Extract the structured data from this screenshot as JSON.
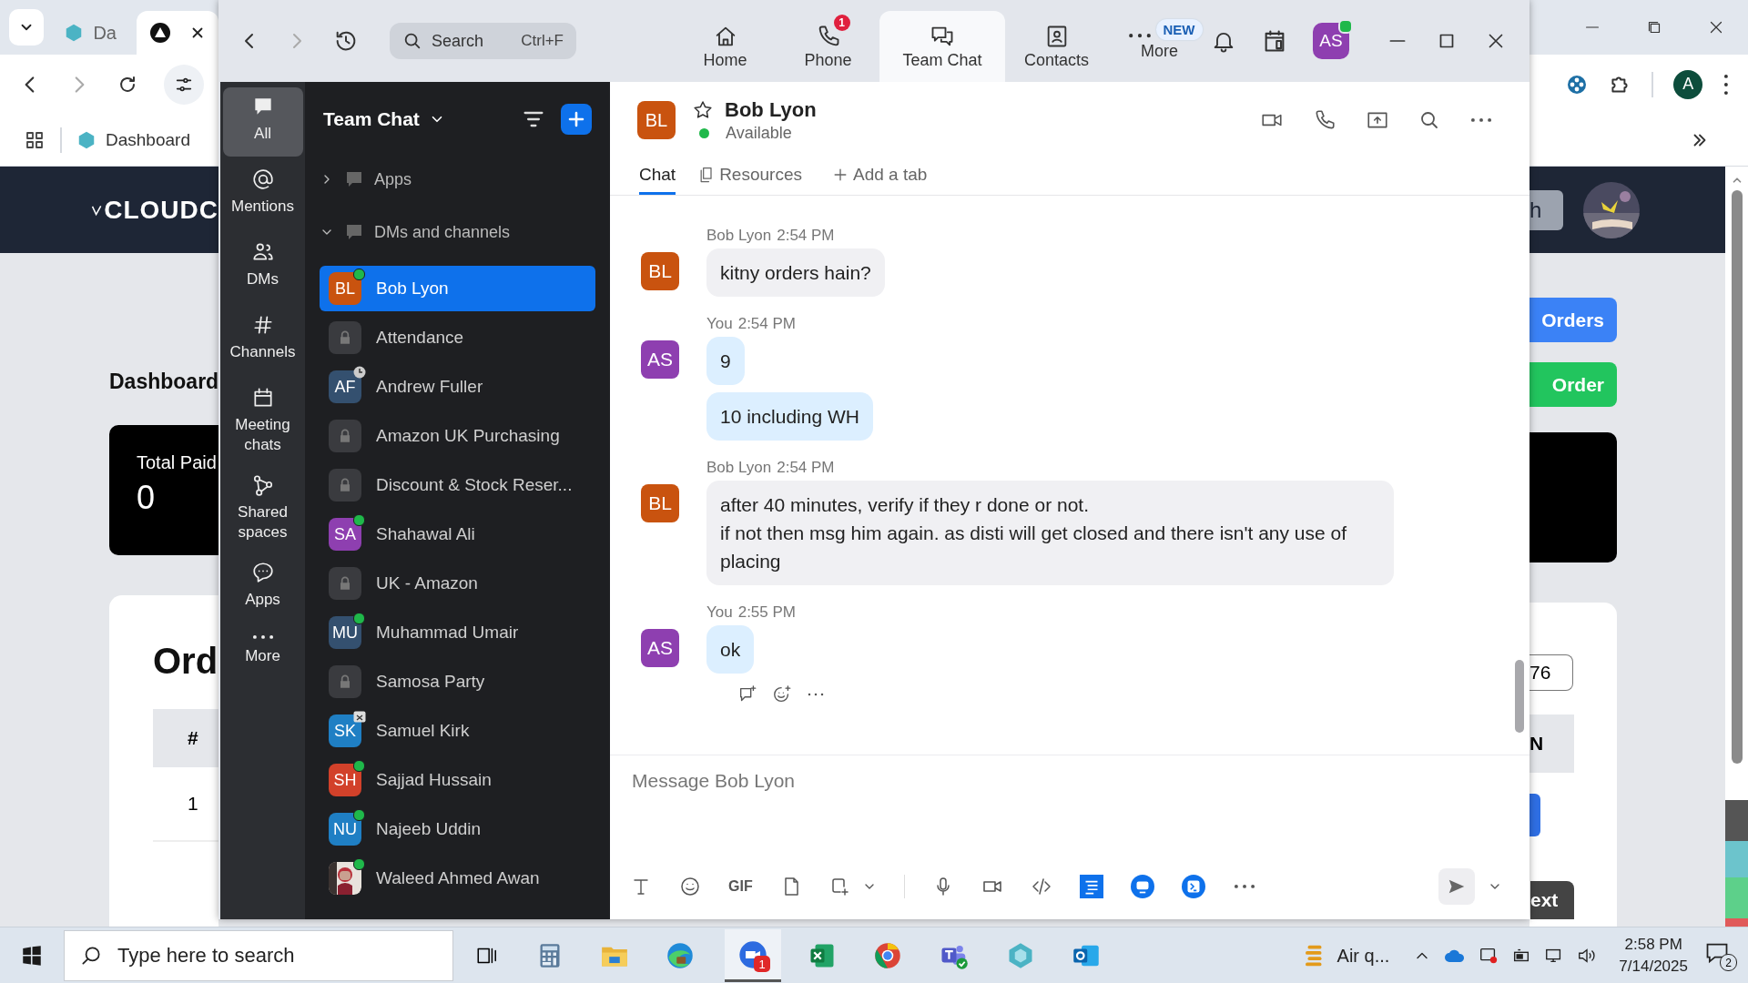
{
  "browser": {
    "tabs": [
      {
        "label": "Da",
        "selected": false
      },
      {
        "selected": true
      }
    ],
    "bookmark": "Dashboard",
    "profile": "A",
    "page": {
      "logo": "CLOUDC",
      "title": "Dashboard",
      "stat": {
        "label": "Total Paid",
        "value": "0"
      },
      "section_title": "Ord",
      "table_header": "#",
      "table_cell": "1",
      "search_button": "h",
      "actions": [
        {
          "label": "Orders",
          "color": "#3b82f6"
        },
        {
          "label": "Order",
          "color": "#22c55e"
        }
      ],
      "filter_value": "76",
      "column_header": "N",
      "pager_button": "ext"
    }
  },
  "zoom": {
    "search": {
      "placeholder": "Search",
      "shortcut": "Ctrl+F"
    },
    "tabs": [
      {
        "label": "Home",
        "kind": "home",
        "selected": false
      },
      {
        "label": "Phone",
        "kind": "phone",
        "selected": false,
        "badge": "1"
      },
      {
        "label": "Team Chat",
        "kind": "chat",
        "selected": true
      },
      {
        "label": "Contacts",
        "kind": "contacts",
        "selected": false
      },
      {
        "label": "More",
        "kind": "more",
        "selected": false,
        "tag": "NEW"
      }
    ],
    "user": {
      "initials": "AS",
      "online": true
    },
    "rail": [
      {
        "label": "All",
        "kind": "all",
        "selected": true
      },
      {
        "label": "Mentions",
        "kind": "mentions",
        "selected": false
      },
      {
        "label": "DMs",
        "kind": "dms",
        "selected": false
      },
      {
        "label": "Channels",
        "kind": "channels",
        "selected": false
      },
      {
        "label": "Meeting chats",
        "kind": "meetings",
        "selected": false
      },
      {
        "label": "Shared spaces",
        "kind": "shared",
        "selected": false
      },
      {
        "label": "Apps",
        "kind": "apps",
        "selected": false
      },
      {
        "label": "More",
        "kind": "more",
        "selected": false
      }
    ],
    "list_title": "Team Chat",
    "sections": [
      {
        "label": "Apps",
        "expanded": false
      },
      {
        "label": "DMs and channels",
        "expanded": true,
        "items": [
          {
            "name": "Bob Lyon",
            "kind": "person",
            "initials": "BL",
            "color": "#c9530f",
            "online": true,
            "away": false,
            "in_meeting": false,
            "selected": true
          },
          {
            "name": "Attendance",
            "kind": "channel",
            "online": false,
            "away": false,
            "in_meeting": false,
            "selected": false
          },
          {
            "name": "Andrew Fuller",
            "kind": "person",
            "initials": "AF",
            "color": "#34506f",
            "online": false,
            "away": true,
            "in_meeting": false,
            "selected": false
          },
          {
            "name": "Amazon UK Purchasing",
            "kind": "channel",
            "online": false,
            "away": false,
            "in_meeting": false,
            "selected": false
          },
          {
            "name": "Discount & Stock Reser...",
            "kind": "channel",
            "online": false,
            "away": false,
            "in_meeting": false,
            "selected": false
          },
          {
            "name": "Shahawal Ali",
            "kind": "person",
            "initials": "SA",
            "color": "#8e3fb0",
            "online": true,
            "away": false,
            "in_meeting": false,
            "selected": false
          },
          {
            "name": "UK - Amazon",
            "kind": "channel",
            "online": false,
            "away": false,
            "in_meeting": false,
            "selected": false
          },
          {
            "name": "Muhammad Umair",
            "kind": "person",
            "initials": "MU",
            "color": "#34506f",
            "online": true,
            "away": false,
            "in_meeting": false,
            "selected": false
          },
          {
            "name": "Samosa Party",
            "kind": "channel",
            "online": false,
            "away": false,
            "in_meeting": false,
            "selected": false
          },
          {
            "name": "Samuel Kirk",
            "kind": "person",
            "initials": "SK",
            "color": "#1f7fc4",
            "online": false,
            "away": false,
            "in_meeting": true,
            "selected": false
          },
          {
            "name": "Sajjad Hussain",
            "kind": "person",
            "initials": "SH",
            "color": "#d2412a",
            "online": true,
            "away": false,
            "in_meeting": false,
            "selected": false
          },
          {
            "name": "Najeeb Uddin",
            "kind": "person",
            "initials": "NU",
            "color": "#1f7fc4",
            "online": true,
            "away": false,
            "in_meeting": false,
            "selected": false
          },
          {
            "name": "Waleed Ahmed Awan",
            "online": true,
            "away": false,
            "in_meeting": false,
            "selected": false
          }
        ]
      }
    ],
    "chat": {
      "contact": {
        "initials": "BL",
        "color": "#c9530f",
        "name": "Bob Lyon",
        "status": "Available",
        "starred": false
      },
      "tabs": [
        {
          "label": "Chat",
          "kind": "chat",
          "selected": true
        },
        {
          "label": "Resources",
          "kind": "resources",
          "selected": false
        }
      ],
      "add_tab": "Add a tab",
      "groups": [
        {
          "sender": "Bob Lyon",
          "time": "2:54 PM",
          "initials": "BL",
          "color": "#c9530f",
          "mine": false,
          "bubbles": [
            "kitny orders hain?"
          ]
        },
        {
          "sender": "You",
          "time": "2:54 PM",
          "initials": "AS",
          "color": "#8e3fb0",
          "mine": true,
          "bubbles": [
            "9",
            "10 including WH"
          ]
        },
        {
          "sender": "Bob Lyon",
          "time": "2:54 PM",
          "initials": "BL",
          "color": "#c9530f",
          "mine": false,
          "bubbles": [
            "after 40 minutes, verify if they r done or not.\nif not then msg him again. as disti will get closed and there isn't any use of placing"
          ]
        },
        {
          "sender": "You",
          "time": "2:55 PM",
          "initials": "AS",
          "color": "#8e3fb0",
          "mine": true,
          "bubbles": [
            "ok"
          ]
        }
      ],
      "composer": {
        "placeholder": "Message Bob Lyon",
        "gif": "GIF"
      }
    }
  },
  "taskbar": {
    "search_placeholder": "Type here to search",
    "zoom_badge": "1",
    "weather": "Air q...",
    "time": "2:58 PM",
    "date": "7/14/2025",
    "notifications": "2"
  }
}
